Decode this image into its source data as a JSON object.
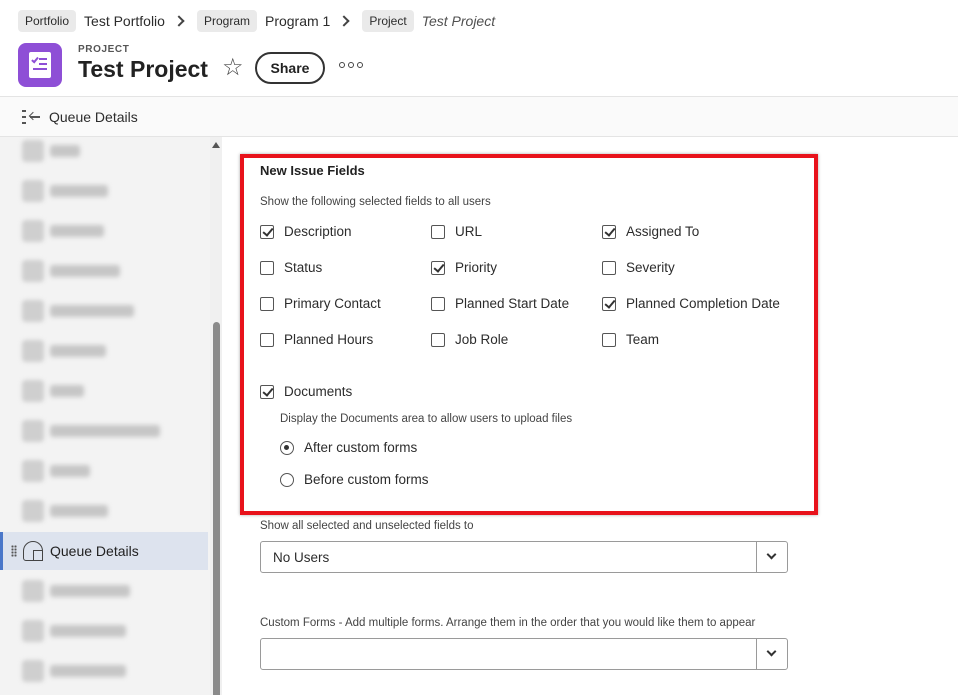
{
  "breadcrumb": {
    "portfolio_chip": "Portfolio",
    "portfolio_name": "Test Portfolio",
    "program_chip": "Program",
    "program_name": "Program 1",
    "project_chip": "Project",
    "project_name": "Test Project"
  },
  "header": {
    "object_type": "PROJECT",
    "title": "Test Project",
    "share_label": "Share",
    "icons": [
      "project-document-icon",
      "star-icon",
      "more-options-icon"
    ]
  },
  "subbar": {
    "label": "Queue Details",
    "icon": "collapse-panel-icon"
  },
  "sidebar": {
    "active_item": "Queue Details",
    "active_icon": "queue-details-icon"
  },
  "form": {
    "section_title": "New Issue Fields",
    "section_subtitle": "Show the following selected fields to all users",
    "fields": [
      {
        "label": "Description",
        "checked": true
      },
      {
        "label": "URL",
        "checked": false
      },
      {
        "label": "Assigned To",
        "checked": true
      },
      {
        "label": "Status",
        "checked": false
      },
      {
        "label": "Priority",
        "checked": true
      },
      {
        "label": "Severity",
        "checked": false
      },
      {
        "label": "Primary Contact",
        "checked": false
      },
      {
        "label": "Planned Start Date",
        "checked": false
      },
      {
        "label": "Planned Completion Date",
        "checked": true
      },
      {
        "label": "Planned Hours",
        "checked": false
      },
      {
        "label": "Job Role",
        "checked": false
      },
      {
        "label": "Team",
        "checked": false
      }
    ],
    "documents": {
      "label": "Documents",
      "checked": true,
      "description": "Display the Documents area to allow users to upload files",
      "options": [
        {
          "label": "After custom forms",
          "selected": true
        },
        {
          "label": "Before custom forms",
          "selected": false
        }
      ]
    },
    "visibility": {
      "label": "Show all selected and unselected fields to",
      "value": "No Users"
    },
    "custom_forms": {
      "label": "Custom Forms - Add multiple forms. Arrange them in the order that you would like them to appear",
      "value": ""
    }
  },
  "colors": {
    "accent": "#8e4fd6",
    "highlight_border": "#e8121b",
    "active_bg": "#dde3ee"
  }
}
